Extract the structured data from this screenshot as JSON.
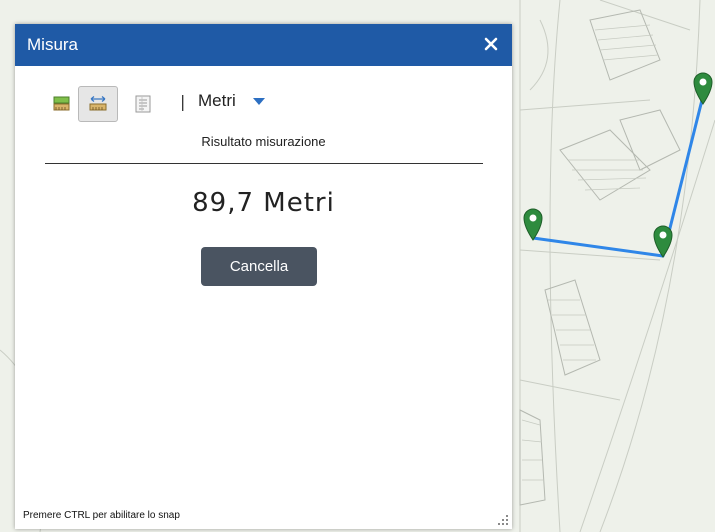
{
  "panel": {
    "title": "Misura",
    "close_icon": "close-icon"
  },
  "toolbar": {
    "tools": [
      {
        "name": "area",
        "icon": "area-measure-icon",
        "active": false
      },
      {
        "name": "distance",
        "icon": "distance-measure-icon",
        "active": true
      },
      {
        "name": "location",
        "icon": "location-measure-icon",
        "active": false
      }
    ],
    "separator": "|",
    "unit_label": "Metri"
  },
  "result": {
    "label": "Risultato misurazione",
    "value": "89,7 Metri"
  },
  "actions": {
    "cancel_label": "Cancella"
  },
  "footer": {
    "hint": "Premere CTRL per abilitare lo snap"
  },
  "colors": {
    "header": "#1f5aa6",
    "measure_line": "#2f86e8",
    "marker": "#2e8b3e",
    "cancel_button": "#4a5461",
    "map_background": "#eef1ea"
  }
}
